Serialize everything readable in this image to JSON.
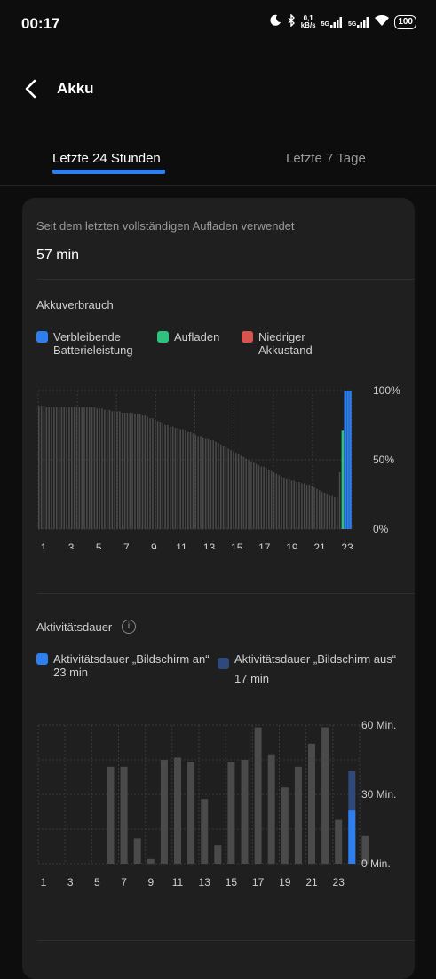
{
  "status_bar": {
    "time": "00:17",
    "net_speed_value": "0,1",
    "net_speed_unit": "kB/s",
    "sim1_label": "5G",
    "sim2_label": "5G",
    "battery_level": "100",
    "icons": [
      "moon-icon",
      "bluetooth-icon",
      "signal-icon",
      "signal-icon",
      "wifi-icon",
      "battery-icon"
    ]
  },
  "header": {
    "title": "Akku",
    "back_icon": "chevron-left-icon"
  },
  "tabs": [
    {
      "label": "Letzte 24 Stunden",
      "active": true
    },
    {
      "label": "Letzte 7 Tage",
      "active": false
    }
  ],
  "summary": {
    "since_label": "Seit dem letzten vollständigen Aufladen verwendet",
    "since_value": "57 min"
  },
  "colors": {
    "accent": "#2d7ff0",
    "charging": "#2ec27e",
    "low": "#d9534f",
    "bar": "#4a4a4a",
    "bar_dark_blue": "#2f4a7a",
    "grid": "#3a3a3a"
  },
  "battery_section": {
    "title": "Akkuverbrauch",
    "legend": [
      {
        "label": "Verbleibende Batterieleistung",
        "color": "#2d7ff0"
      },
      {
        "label": "Aufladen",
        "color": "#2ec27e"
      },
      {
        "label": "Niedriger Akkustand",
        "color": "#d9534f"
      }
    ]
  },
  "activity_section": {
    "title": "Aktivitätsdauer",
    "legend": [
      {
        "label": "Aktivitätsdauer „Bildschirm an“",
        "value": "23 min",
        "color": "#2d7ff0"
      },
      {
        "label": "Aktivitätsdauer „Bildschirm aus“",
        "value": "17 min",
        "color": "#2f4a7a"
      }
    ]
  },
  "chart_data": [
    {
      "type": "bar",
      "title": "Akkuverbrauch",
      "x_tick_labels": [
        "1",
        "3",
        "5",
        "7",
        "9",
        "11",
        "13",
        "15",
        "17",
        "19",
        "21",
        "23"
      ],
      "y_tick_labels": [
        "100%",
        "50%",
        "0%"
      ],
      "ylim": [
        0,
        100
      ],
      "grid": true,
      "series": [
        {
          "name": "Verbleibende Batterieleistung",
          "values": [
            89,
            89,
            89,
            88,
            88,
            88,
            88,
            88,
            88,
            88,
            88,
            88,
            88,
            88,
            88,
            88,
            88,
            88,
            88,
            88,
            88,
            88,
            88,
            87,
            87,
            87,
            86,
            86,
            86,
            85,
            85,
            85,
            85,
            84,
            84,
            84,
            84,
            84,
            83,
            83,
            83,
            82,
            82,
            81,
            80,
            80,
            79,
            78,
            77,
            76,
            75,
            75,
            74,
            74,
            73,
            73,
            72,
            72,
            71,
            70,
            70,
            69,
            68,
            67,
            67,
            66,
            65,
            65,
            64,
            64,
            63,
            62,
            61,
            60,
            59,
            58,
            57,
            56,
            55,
            54,
            53,
            52,
            51,
            50,
            49,
            48,
            47,
            46,
            45,
            45,
            44,
            43,
            42,
            41,
            40,
            39,
            38,
            37,
            36,
            36,
            35,
            35,
            34,
            34,
            33,
            33,
            32,
            32,
            31,
            30,
            29,
            28,
            27,
            26,
            25,
            24,
            24,
            23,
            23,
            41,
            71,
            100,
            100,
            100
          ]
        }
      ]
    },
    {
      "type": "bar",
      "title": "Aktivitätsdauer",
      "categories": [
        "0",
        "1",
        "2",
        "3",
        "4",
        "5",
        "6",
        "7",
        "8",
        "9",
        "10",
        "11",
        "12",
        "13",
        "14",
        "15",
        "16",
        "17",
        "18",
        "19",
        "20",
        "21",
        "22",
        "23",
        "24"
      ],
      "x_tick_labels": [
        "1",
        "3",
        "5",
        "7",
        "9",
        "11",
        "13",
        "15",
        "17",
        "19",
        "21",
        "23"
      ],
      "y_tick_labels": [
        "60 Min.",
        "30 Min.",
        "0 Min."
      ],
      "ylim": [
        0,
        60
      ],
      "grid": true,
      "series": [
        {
          "name": "Aktivitätsdauer „Bildschirm an“",
          "values": [
            0,
            0,
            0,
            0,
            0,
            0,
            0,
            0,
            0,
            0,
            0,
            0,
            0,
            0,
            0,
            0,
            0,
            0,
            0,
            0,
            0,
            0,
            0,
            23,
            0
          ]
        },
        {
          "name": "Aktivitätsdauer „Bildschirm aus“",
          "values": [
            0,
            0,
            0,
            0,
            0,
            42,
            42,
            11,
            2,
            45,
            46,
            44,
            28,
            8,
            44,
            45,
            59,
            47,
            33,
            42,
            52,
            59,
            19,
            40,
            12
          ]
        }
      ]
    }
  ]
}
